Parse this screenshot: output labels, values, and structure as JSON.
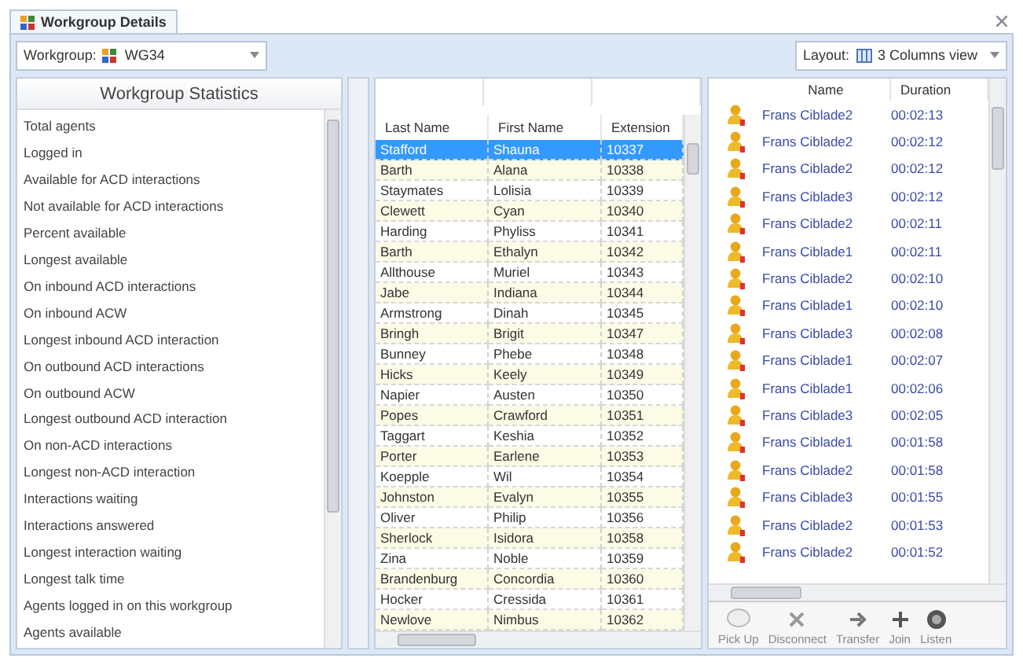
{
  "tab": {
    "title": "Workgroup Details"
  },
  "toolbar": {
    "workgroup_label": "Workgroup:",
    "workgroup_value": "WG34",
    "layout_label": "Layout:",
    "layout_value": "3 Columns view"
  },
  "statistics": {
    "title": "Workgroup Statistics",
    "items": [
      "Total agents",
      "Logged in",
      "Available for ACD interactions",
      "Not available for ACD interactions",
      "Percent available",
      "Longest available",
      "On inbound ACD interactions",
      "On inbound ACW",
      "Longest inbound ACD interaction",
      "On outbound ACD interactions",
      "On outbound ACW",
      "Longest outbound ACD interaction",
      "On non-ACD interactions",
      "Longest non-ACD interaction",
      "Interactions waiting",
      "Interactions answered",
      "Longest interaction waiting",
      "Longest talk time",
      "Agents logged in on this workgroup",
      "Agents available"
    ]
  },
  "agents": {
    "columns": [
      "Last Name",
      "First Name",
      "Extension"
    ],
    "rows": [
      {
        "cells": [
          "Stafford",
          "Shauna",
          "10337"
        ],
        "selected": true
      },
      {
        "cells": [
          "Barth",
          "Alana",
          "10338"
        ],
        "selected": false
      },
      {
        "cells": [
          "Staymates",
          "Lolisia",
          "10339"
        ],
        "selected": false
      },
      {
        "cells": [
          "Clewett",
          "Cyan",
          "10340"
        ],
        "selected": false
      },
      {
        "cells": [
          "Harding",
          "Phyliss",
          "10341"
        ],
        "selected": false
      },
      {
        "cells": [
          "Barth",
          "Ethalyn",
          "10342"
        ],
        "selected": false
      },
      {
        "cells": [
          "Allthouse",
          "Muriel",
          "10343"
        ],
        "selected": false
      },
      {
        "cells": [
          "Jabe",
          "Indiana",
          "10344"
        ],
        "selected": false
      },
      {
        "cells": [
          "Armstrong",
          "Dinah",
          "10345"
        ],
        "selected": false
      },
      {
        "cells": [
          "Bringh",
          "Brigit",
          "10347"
        ],
        "selected": false
      },
      {
        "cells": [
          "Bunney",
          "Phebe",
          "10348"
        ],
        "selected": false
      },
      {
        "cells": [
          "Hicks",
          "Keely",
          "10349"
        ],
        "selected": false
      },
      {
        "cells": [
          "Napier",
          "Austen",
          "10350"
        ],
        "selected": false
      },
      {
        "cells": [
          "Popes",
          "Crawford",
          "10351"
        ],
        "selected": false
      },
      {
        "cells": [
          "Taggart",
          "Keshia",
          "10352"
        ],
        "selected": false
      },
      {
        "cells": [
          "Porter",
          "Earlene",
          "10353"
        ],
        "selected": false
      },
      {
        "cells": [
          "Koepple",
          "Wil",
          "10354"
        ],
        "selected": false
      },
      {
        "cells": [
          "Johnston",
          "Evalyn",
          "10355"
        ],
        "selected": false
      },
      {
        "cells": [
          "Oliver",
          "Philip",
          "10356"
        ],
        "selected": false
      },
      {
        "cells": [
          "Sherlock",
          "Isidora",
          "10358"
        ],
        "selected": false
      },
      {
        "cells": [
          "Zina",
          "Noble",
          "10359"
        ],
        "selected": false
      },
      {
        "cells": [
          "Brandenburg",
          "Concordia",
          "10360"
        ],
        "selected": false
      },
      {
        "cells": [
          "Hocker",
          "Cressida",
          "10361"
        ],
        "selected": false
      },
      {
        "cells": [
          "Newlove",
          "Nimbus",
          "10362"
        ],
        "selected": false
      }
    ]
  },
  "interactions": {
    "columns": [
      "Name",
      "Duration"
    ],
    "rows": [
      {
        "name": "Frans Ciblade2",
        "duration": "00:02:13"
      },
      {
        "name": "Frans Ciblade2",
        "duration": "00:02:12"
      },
      {
        "name": "Frans Ciblade2",
        "duration": "00:02:12"
      },
      {
        "name": "Frans Ciblade3",
        "duration": "00:02:12"
      },
      {
        "name": "Frans Ciblade2",
        "duration": "00:02:11"
      },
      {
        "name": "Frans Ciblade1",
        "duration": "00:02:11"
      },
      {
        "name": "Frans Ciblade2",
        "duration": "00:02:10"
      },
      {
        "name": "Frans Ciblade1",
        "duration": "00:02:10"
      },
      {
        "name": "Frans Ciblade3",
        "duration": "00:02:08"
      },
      {
        "name": "Frans Ciblade1",
        "duration": "00:02:07"
      },
      {
        "name": "Frans Ciblade1",
        "duration": "00:02:06"
      },
      {
        "name": "Frans Ciblade3",
        "duration": "00:02:05"
      },
      {
        "name": "Frans Ciblade1",
        "duration": "00:01:58"
      },
      {
        "name": "Frans Ciblade2",
        "duration": "00:01:58"
      },
      {
        "name": "Frans Ciblade3",
        "duration": "00:01:55"
      },
      {
        "name": "Frans Ciblade2",
        "duration": "00:01:53"
      },
      {
        "name": "Frans Ciblade2",
        "duration": "00:01:52"
      }
    ],
    "actions": [
      {
        "label": "Pick Up",
        "kind": "pickup"
      },
      {
        "label": "Disconnect",
        "kind": "disconnect"
      },
      {
        "label": "Transfer",
        "kind": "transfer"
      },
      {
        "label": "Join",
        "kind": "join"
      },
      {
        "label": "Listen",
        "kind": "listen"
      }
    ]
  }
}
